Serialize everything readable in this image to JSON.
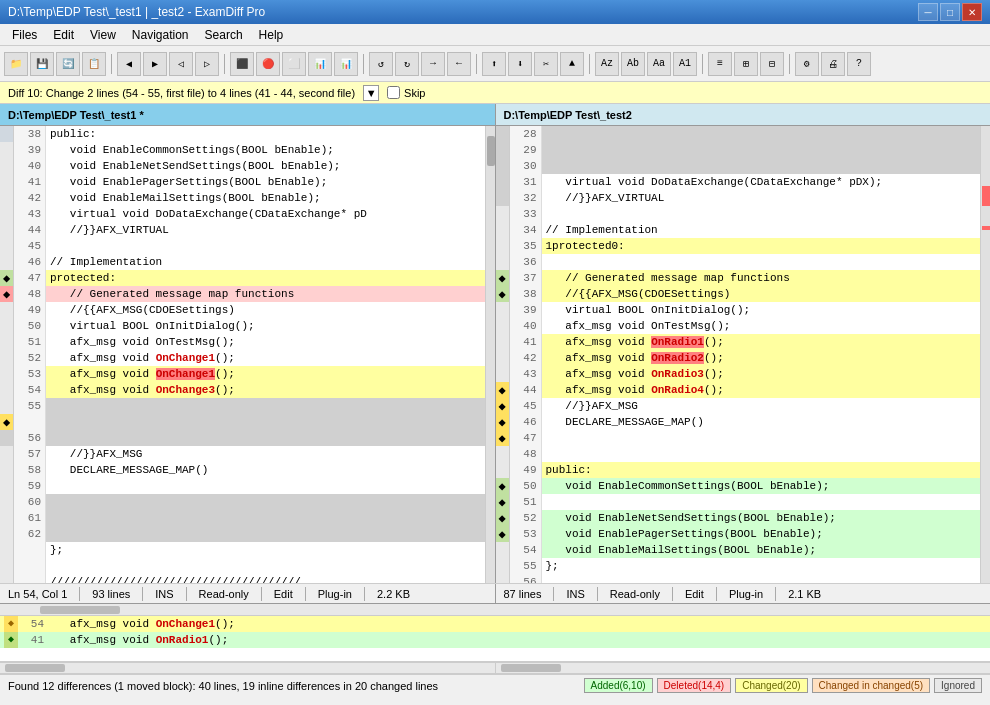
{
  "titlebar": {
    "title": "D:\\Temp\\EDP Test\\_test1 | _test2 - ExamDiff Pro",
    "min": "─",
    "max": "□",
    "close": "✕"
  },
  "menu": {
    "items": [
      "Files",
      "Edit",
      "View",
      "Navigation",
      "Search",
      "Help"
    ]
  },
  "diffbar": {
    "text": "Diff 10: Change 2 lines (54 - 55, first file) to 4 lines (41 - 44, second file)",
    "skip_label": "Skip"
  },
  "pane_left": {
    "header": "D:\\Temp\\EDP Test\\_test1 *",
    "status": {
      "position": "Ln 54, Col 1",
      "lines": "93 lines",
      "ins": "INS",
      "readonly": "Read-only",
      "edit": "Edit",
      "plugin": "Plug-in",
      "size": "2.2 KB"
    }
  },
  "pane_right": {
    "header": "D:\\Temp\\EDP Test\\_test2",
    "status": {
      "lines": "87 lines",
      "ins": "INS",
      "readonly": "Read-only",
      "edit": "Edit",
      "plugin": "Plug-in",
      "size": "2.1 KB"
    }
  },
  "bottom_status": {
    "message": "Found 12 differences (1 moved block): 40 lines, 19 inline differences in 20 changed lines",
    "added": "Added(6,10)",
    "deleted": "Deleted(14,4)",
    "changed": "Changed(20)",
    "changed_in": "Changed in changed(5)",
    "ignored": "Ignored"
  }
}
